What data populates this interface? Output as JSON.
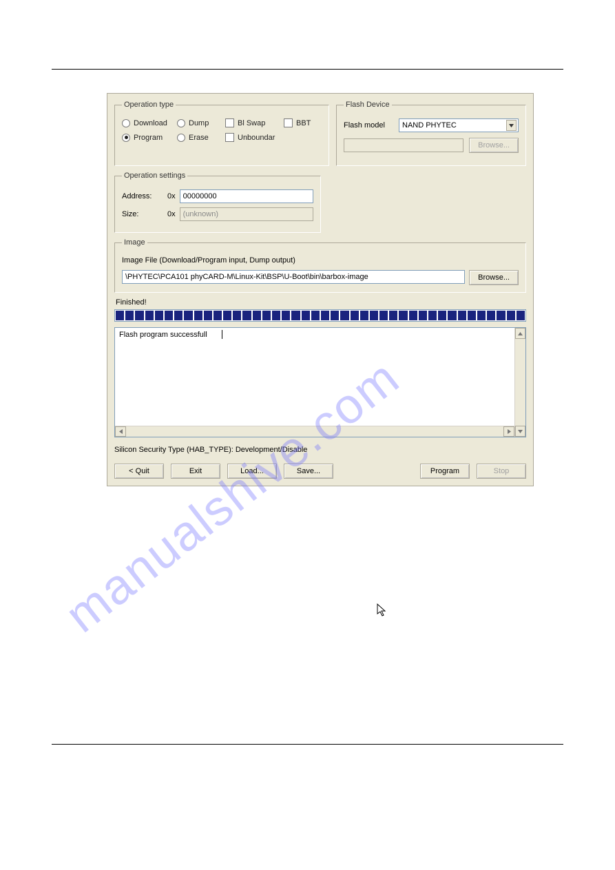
{
  "operation_type": {
    "legend": "Operation type",
    "radios": {
      "download": "Download",
      "program": "Program",
      "dump": "Dump",
      "erase": "Erase"
    },
    "selected": "program",
    "checks": {
      "blswap": "Bl Swap",
      "bbt": "BBT",
      "unboundar": "Unboundar"
    }
  },
  "flash_device": {
    "legend": "Flash Device",
    "model_label": "Flash model",
    "model_value": "NAND PHYTEC",
    "browse": "Browse..."
  },
  "operation_settings": {
    "legend": "Operation settings",
    "address_label": "Address:",
    "address_prefix": "0x",
    "address_value": "00000000",
    "size_label": "Size:",
    "size_prefix": "0x",
    "size_placeholder": "(unknown)"
  },
  "image": {
    "legend": "Image",
    "desc": "Image File (Download/Program input, Dump output)",
    "path": "\\PHYTEC\\PCA101 phyCARD-M\\Linux-Kit\\BSP\\U-Boot\\bin\\barbox-image",
    "browse": "Browse..."
  },
  "status": "Finished!",
  "log_text": "Flash program successfull",
  "security_line": "Silicon Security Type (HAB_TYPE):   Development/Disable",
  "buttons": {
    "quit": "< Quit",
    "exit": "Exit",
    "load": "Load...",
    "save": "Save...",
    "program": "Program",
    "stop": "Stop"
  },
  "watermark": "manualshive.com"
}
